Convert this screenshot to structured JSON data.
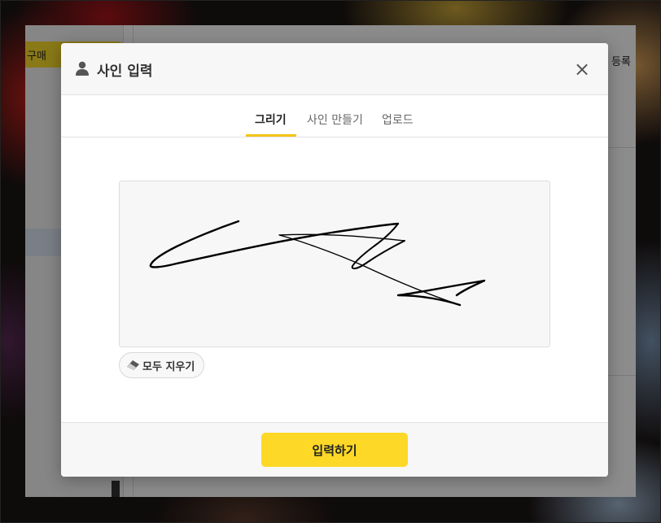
{
  "background_app": {
    "buy_label": "구매",
    "top_right_text": "등록"
  },
  "modal": {
    "title": "사인 입력",
    "title_icon": "user-icon",
    "close_icon": "close-icon",
    "close_glyph": "×",
    "tabs": [
      {
        "label": "그리기",
        "active": true
      },
      {
        "label": "사인 만들기",
        "active": false
      },
      {
        "label": "업로드",
        "active": false
      }
    ],
    "clear_button": {
      "label": "모두 지우기",
      "icon": "eraser-icon"
    },
    "submit_label": "입력하기"
  },
  "colors": {
    "accent": "#f5c518",
    "submit_bg": "#fdd826",
    "canvas_bg": "#f7f7f7",
    "ink": "#000000"
  }
}
